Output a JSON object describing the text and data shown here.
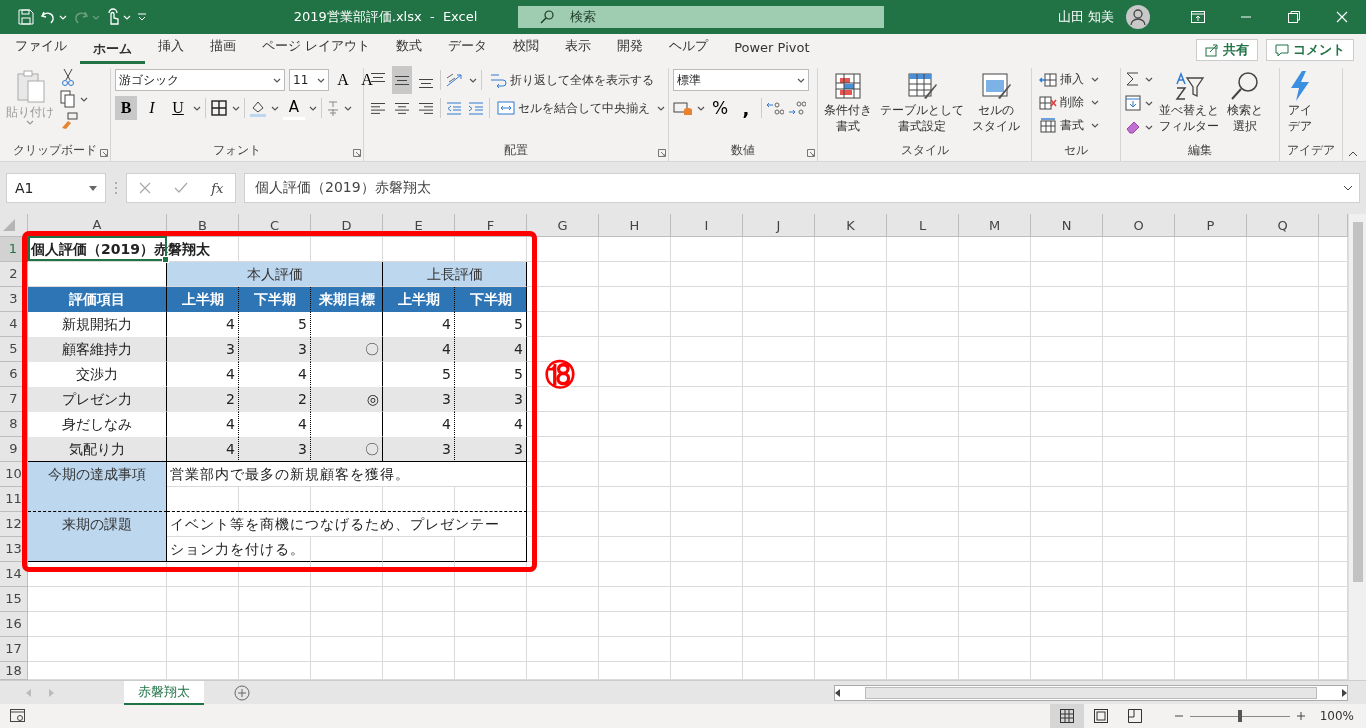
{
  "title_bar": {
    "file_title": "2019営業部評価.xlsx  -  Excel",
    "search_placeholder": "検索",
    "user": "山田 知美"
  },
  "menu_tabs": [
    {
      "label": "ファイル",
      "selected": false
    },
    {
      "label": "ホーム",
      "selected": true
    },
    {
      "label": "挿入",
      "selected": false
    },
    {
      "label": "描画",
      "selected": false
    },
    {
      "label": "ページ レイアウト",
      "selected": false
    },
    {
      "label": "数式",
      "selected": false
    },
    {
      "label": "データ",
      "selected": false
    },
    {
      "label": "校閲",
      "selected": false
    },
    {
      "label": "表示",
      "selected": false
    },
    {
      "label": "開発",
      "selected": false
    },
    {
      "label": "ヘルプ",
      "selected": false
    },
    {
      "label": "Power Pivot",
      "selected": false
    }
  ],
  "share_button": "共有",
  "comment_button": "コメント",
  "ribbon": {
    "clipboard": {
      "paste": "貼り付け",
      "paste_disabled": true,
      "label": "クリップボード"
    },
    "font": {
      "name": "游ゴシック",
      "size": "11",
      "grow": "A",
      "shrink": "A",
      "font_color": "A",
      "label": "フォント",
      "styles": [
        {
          "kind": "bold",
          "label": "B",
          "selected": true
        },
        {
          "kind": "italic",
          "label": "I",
          "selected": false
        },
        {
          "kind": "underline",
          "label": "U",
          "selected": false
        }
      ]
    },
    "alignment": {
      "label": "配置",
      "vertical": [
        {
          "kind": "top",
          "selected": false
        },
        {
          "kind": "middle",
          "selected": true
        },
        {
          "kind": "bottom",
          "selected": false
        }
      ],
      "horizontal": [
        {
          "kind": "left",
          "selected": false
        },
        {
          "kind": "center",
          "selected": false
        },
        {
          "kind": "right",
          "selected": false
        }
      ],
      "wrap": "折り返して全体を表示する",
      "merge": "セルを結合して中央揃え"
    },
    "number": {
      "format": "標準",
      "percent": "%",
      "comma": ",",
      "label": "数値"
    },
    "styles": {
      "label": "スタイル",
      "buttons": [
        {
          "kind": "conditional",
          "lines": [
            "条件付き",
            "書式"
          ]
        },
        {
          "kind": "table",
          "lines": [
            "テーブルとして",
            "書式設定"
          ]
        },
        {
          "kind": "cell",
          "lines": [
            "セルの",
            "スタイル"
          ]
        }
      ]
    },
    "cells": {
      "label": "セル",
      "buttons": [
        {
          "kind": "insert",
          "label": "挿入"
        },
        {
          "kind": "delete",
          "label": "削除"
        },
        {
          "kind": "format",
          "label": "書式"
        }
      ]
    },
    "editing": {
      "label": "編集",
      "buttons": [
        {
          "kind": "sort",
          "lines": [
            "並べ替えと",
            "フィルター"
          ]
        },
        {
          "kind": "find",
          "lines": [
            "検索と",
            "選択"
          ]
        }
      ]
    },
    "ideas": {
      "label": "アイデア",
      "button_lines": [
        "アイ",
        "デア"
      ]
    }
  },
  "formula_bar": {
    "name_box": "A1",
    "function_label": "fx",
    "formula": "個人評価（2019）赤磐翔太"
  },
  "sheet": {
    "columns": [
      {
        "label": "A",
        "selected": true
      },
      {
        "label": "B",
        "selected": false
      },
      {
        "label": "C",
        "selected": false
      },
      {
        "label": "D",
        "selected": false
      },
      {
        "label": "E",
        "selected": false
      },
      {
        "label": "F",
        "selected": false
      },
      {
        "label": "G",
        "selected": false
      },
      {
        "label": "H",
        "selected": false
      },
      {
        "label": "I",
        "selected": false
      },
      {
        "label": "J",
        "selected": false
      },
      {
        "label": "K",
        "selected": false
      },
      {
        "label": "L",
        "selected": false
      },
      {
        "label": "M",
        "selected": false
      },
      {
        "label": "N",
        "selected": false
      },
      {
        "label": "O",
        "selected": false
      },
      {
        "label": "P",
        "selected": false
      },
      {
        "label": "Q",
        "selected": false
      }
    ],
    "rows": [
      {
        "label": "1",
        "selected": true
      },
      {
        "label": "2",
        "selected": false
      },
      {
        "label": "3",
        "selected": false
      },
      {
        "label": "4",
        "selected": false
      },
      {
        "label": "5",
        "selected": false
      },
      {
        "label": "6",
        "selected": false
      },
      {
        "label": "7",
        "selected": false
      },
      {
        "label": "8",
        "selected": false
      },
      {
        "label": "9",
        "selected": false
      },
      {
        "label": "10",
        "selected": false
      },
      {
        "label": "11",
        "selected": false
      },
      {
        "label": "12",
        "selected": false
      },
      {
        "label": "13",
        "selected": false
      },
      {
        "label": "14",
        "selected": false
      },
      {
        "label": "15",
        "selected": false
      },
      {
        "label": "16",
        "selected": false
      },
      {
        "label": "17",
        "selected": false
      },
      {
        "label": "18",
        "selected": false
      }
    ],
    "table": {
      "title": "個人評価（2019）赤磐翔太",
      "groups": [
        {
          "label": "本人評価"
        },
        {
          "label": "上長評価"
        }
      ],
      "headers": [
        "評価項目",
        "上半期",
        "下半期",
        "来期目標",
        "上半期",
        "下半期"
      ],
      "items": [
        {
          "name": "新規開拓力",
          "self_first": "4",
          "self_second": "5",
          "boss_first": "4",
          "boss_second": "5"
        },
        {
          "name": "顧客維持力",
          "self_first": "3",
          "self_second": "3",
          "next_goal": "〇",
          "boss_first": "4",
          "boss_second": "4"
        },
        {
          "name": "交渉力",
          "self_first": "4",
          "self_second": "4",
          "boss_first": "5",
          "boss_second": "5"
        },
        {
          "name": "プレゼン力",
          "self_first": "2",
          "self_second": "2",
          "next_goal": "◎",
          "boss_first": "3",
          "boss_second": "3"
        },
        {
          "name": "身だしなみ",
          "self_first": "4",
          "self_second": "4",
          "boss_first": "4",
          "boss_second": "4"
        },
        {
          "name": "気配り力",
          "self_first": "4",
          "self_second": "3",
          "next_goal": "〇",
          "boss_first": "3",
          "boss_second": "3"
        }
      ],
      "achievements": {
        "label": "今期の達成事項",
        "text": "営業部内で最多の新規顧客を獲得。"
      },
      "issues": {
        "label": "来期の課題",
        "lines": [
          "イベント等を商機につなげるため、プレゼンテー",
          "ション力を付ける。"
        ]
      }
    }
  },
  "annotation": {
    "label": "⑱"
  },
  "sheet_tabs": [
    {
      "label": "赤磐翔太",
      "selected": true
    }
  ],
  "status_bar": {
    "views": [
      {
        "kind": "normal",
        "selected": true
      },
      {
        "kind": "page_layout",
        "selected": false
      },
      {
        "kind": "page_break",
        "selected": false
      }
    ],
    "zoom": {
      "level": 0.5,
      "reading": "100%"
    }
  }
}
